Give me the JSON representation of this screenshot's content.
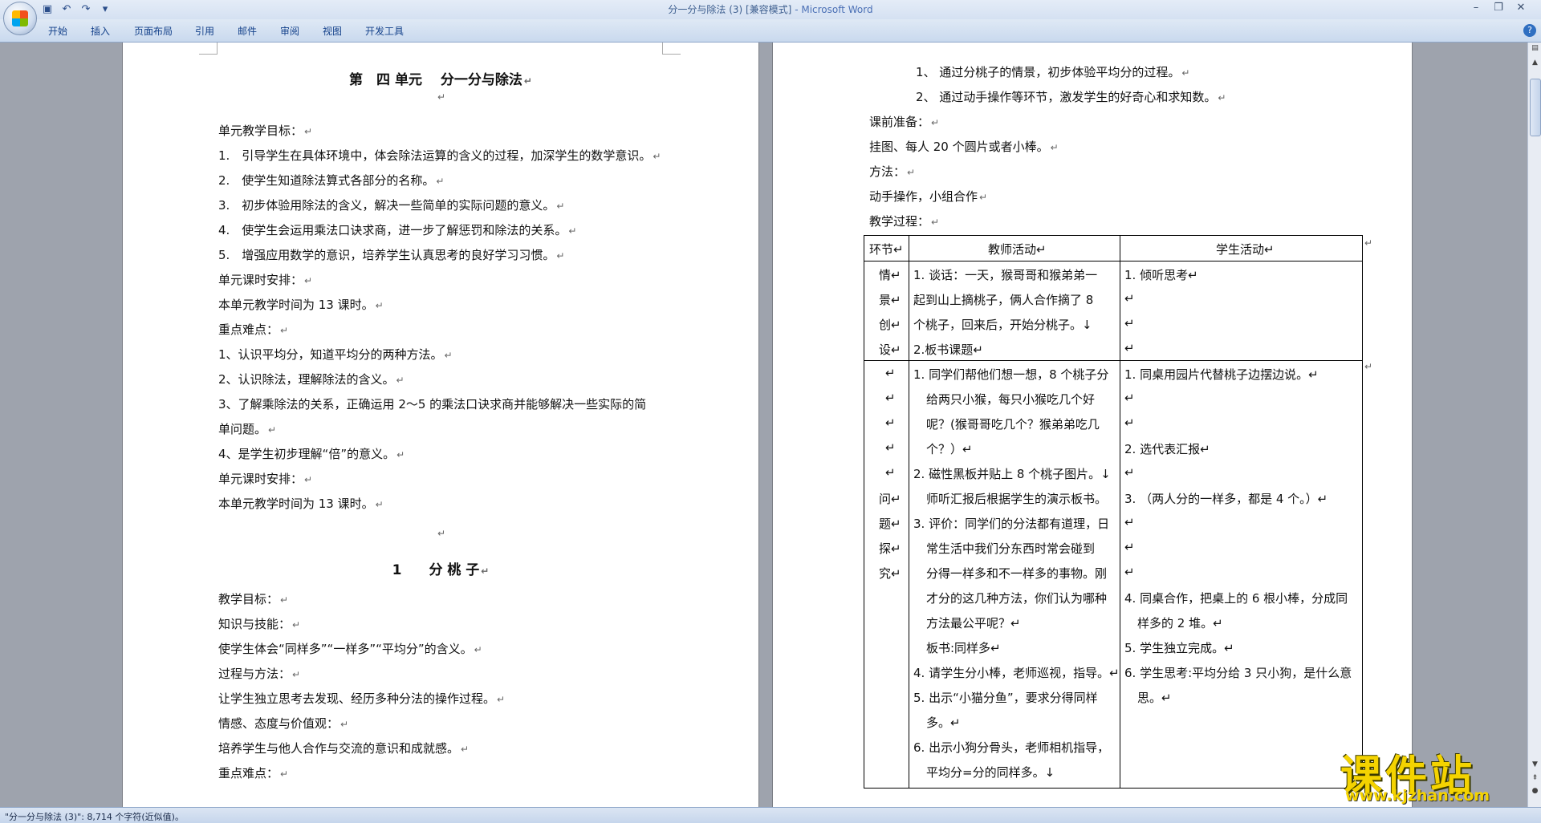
{
  "window": {
    "title": "分一分与除法 (3) [兼容模式]",
    "app_name": " - Microsoft Word",
    "qat_icons": [
      "save-icon",
      "undo-icon",
      "redo-icon",
      "customize-icon"
    ]
  },
  "ribbon": {
    "tabs": [
      "开始",
      "插入",
      "页面布局",
      "引用",
      "邮件",
      "审阅",
      "视图",
      "开发工具"
    ]
  },
  "status": {
    "text": "\"分一分与除法 (3)\": 8,714 个字符(近似值)。"
  },
  "watermark": {
    "title": "课件站",
    "url": "www.kjzhan.com"
  },
  "left_page": {
    "heading": "第　四 单元　 分一分与除法",
    "lines": [
      "单元教学目标：",
      "1.　引导学生在具体环境中，体会除法运算的含义的过程，加深学生的数学意识。",
      "2.　使学生知道除法算式各部分的名称。",
      "3.　初步体验用除法的含义，解决一些简单的实际问题的意义。",
      "4.　使学生会运用乘法口诀求商，进一步了解惩罚和除法的关系。",
      "5.　增强应用数学的意识，培养学生认真思考的良好学习习惯。",
      "单元课时安排：",
      "本单元教学时间为 13 课时。",
      "重点难点：",
      "1、认识平均分，知道平均分的两种方法。",
      "2、认识除法，理解除法的含义。",
      "3、了解乘除法的关系，正确运用 2～5 的乘法口诀求商并能够解决一些实际的简",
      "单问题。",
      "4、是学生初步理解“倍”的意义。",
      "单元课时安排：",
      "本单元教学时间为 13 课时。"
    ],
    "lesson_heading": "1　　分 桃 子",
    "lines2": [
      "教学目标：",
      "知识与技能：",
      "使学生体会“同样多”“一样多”“平均分”的含义。",
      "过程与方法：",
      "让学生独立思考去发现、经历多种分法的操作过程。",
      "情感、态度与价值观：",
      "培养学生与他人合作与交流的意识和成就感。",
      "重点难点："
    ]
  },
  "right_page": {
    "intro": [
      "1、 通过分桃子的情景，初步体验平均分的过程。",
      "2、 通过动手操作等环节，激发学生的好奇心和求知数。",
      "课前准备：",
      "挂图、每人 20 个圆片或者小棒。",
      "方法：",
      "动手操作，小组合作",
      "教学过程："
    ],
    "table": {
      "headers": [
        "环节",
        "教师活动",
        "学生活动"
      ],
      "row1": {
        "stage": [
          "情",
          "景",
          "创",
          "设"
        ],
        "teacher": [
          "1. 谈话：一天，猴哥哥和猴弟弟一",
          "起到山上摘桃子，俩人合作摘了 8",
          "个桃子，回来后，开始分桃子。",
          "2.板书课题"
        ],
        "student": [
          "1. 倾听思考",
          "",
          "",
          ""
        ]
      },
      "row2": {
        "stage": [
          "",
          "",
          "",
          "",
          "",
          "问",
          "题",
          "探",
          "究"
        ],
        "teacher": [
          "1. 同学们帮他们想一想，8 个桃子分",
          "给两只小猴，每只小猴吃几个好",
          "呢？(猴哥哥吃几个？猴弟弟吃几",
          "个？）",
          "2. 磁性黑板并贴上 8 个桃子图片。",
          "师听汇报后根据学生的演示板书。",
          "3. 评价：同学们的分法都有道理，日",
          "常生活中我们分东西时常会碰到",
          "分得一样多和不一样多的事物。刚",
          "才分的这几种方法，你们认为哪种",
          "方法最公平呢？",
          "板书:同样多",
          "4. 请学生分小棒，老师巡视，指导。",
          "5. 出示“小猫分鱼”，要求分得同样",
          "多。",
          "6. 出示小狗分骨头，老师相机指导，",
          "平均分=分的同样多。"
        ],
        "student": [
          "1. 同桌用园片代替桃子边摆边说。",
          "",
          "",
          "2. 选代表汇报",
          "",
          "3. （两人分的一样多，都是 4 个。）",
          "",
          "",
          "",
          "4. 同桌合作，把桌上的 6 根小棒，分成同",
          "样多的 2 堆。",
          "5. 学生独立完成。",
          "6. 学生思考:平均分给 3 只小狗，是什么意",
          "思。"
        ]
      }
    }
  }
}
